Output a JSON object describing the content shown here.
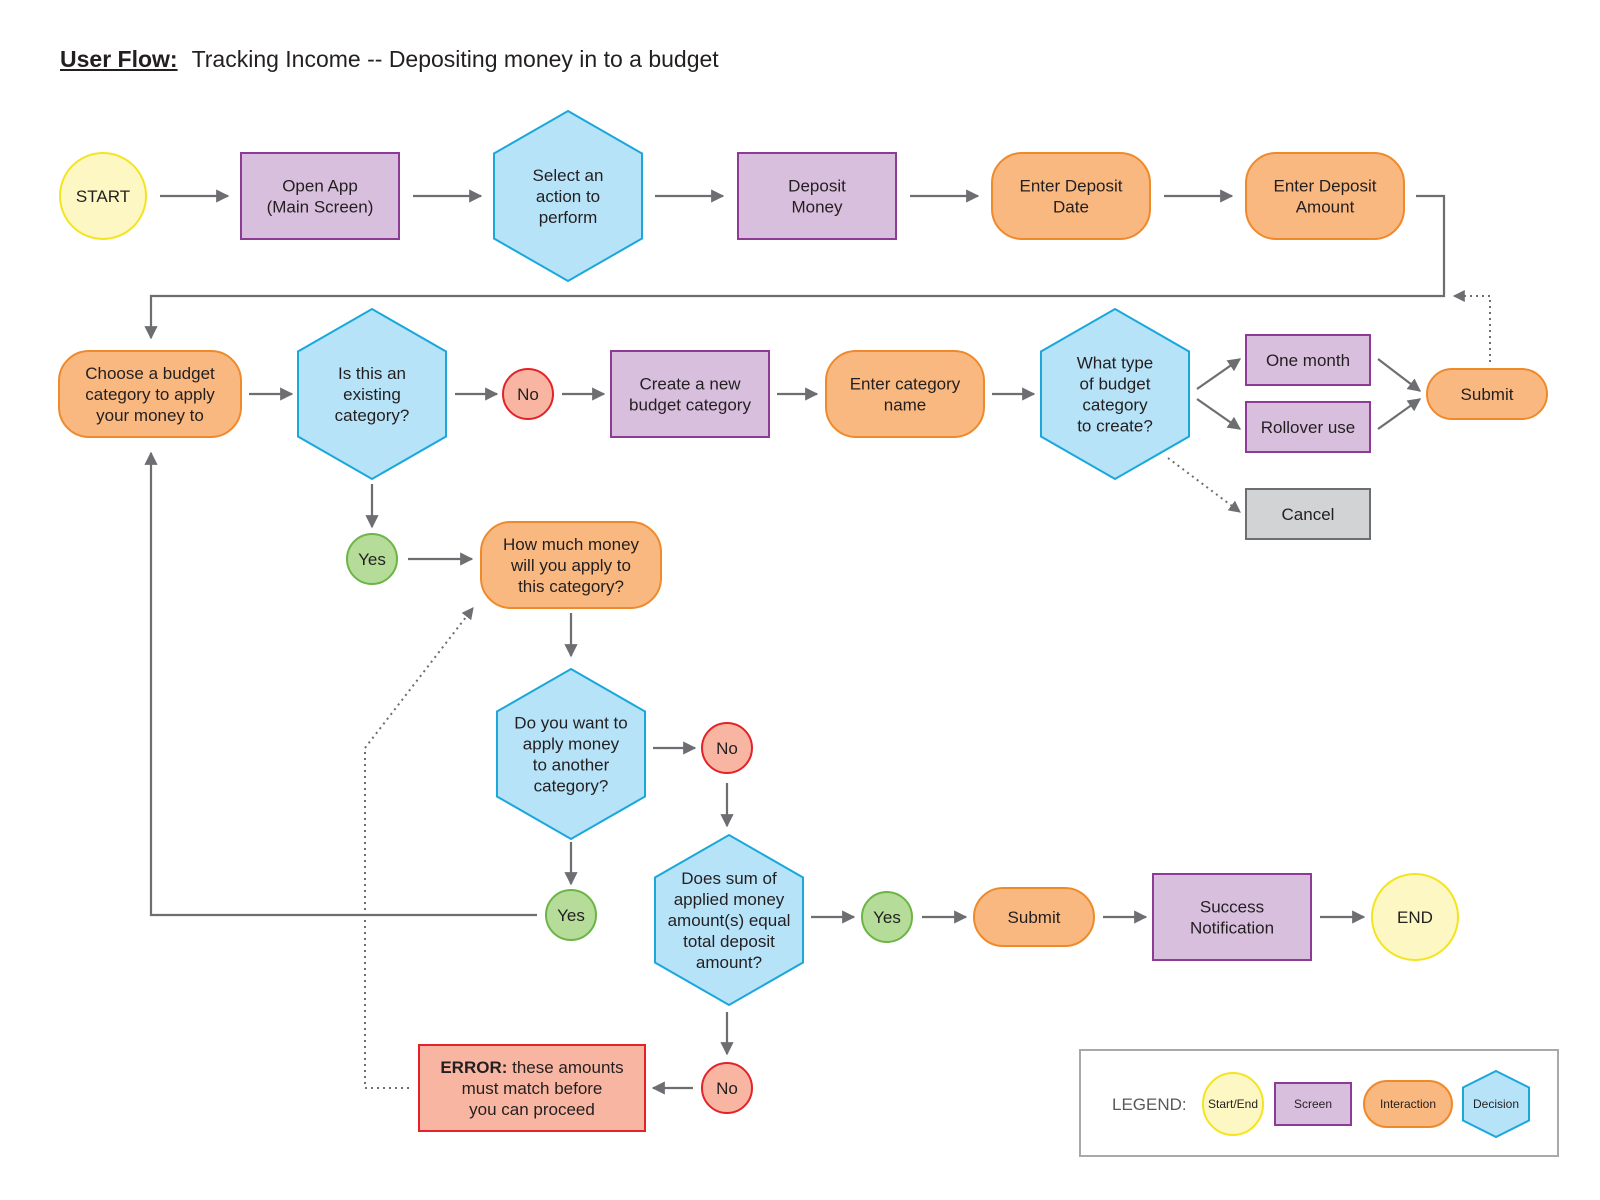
{
  "title": {
    "lead": "User Flow:",
    "text": "Tracking Income -- Depositing money in to a budget"
  },
  "colors": {
    "start_end_fill": "#fdf7c3",
    "start_end_stroke": "#f2e520",
    "screen_fill": "#d9bfde",
    "screen_stroke": "#8e3b96",
    "interaction_fill": "#f9b880",
    "interaction_stroke": "#ef8a2c",
    "decision_fill": "#b7e3f8",
    "decision_stroke": "#1aa7dc",
    "yes_fill": "#b5dc98",
    "yes_stroke": "#6db446",
    "no_fill": "#f8b6a2",
    "no_stroke": "#e2232a",
    "error_fill": "#f8b6a2",
    "error_stroke": "#e2232a",
    "cancel_fill": "#d1d3d4",
    "cancel_stroke": "#6d6e71",
    "edge": "#6d6e71"
  },
  "nodes": {
    "start": {
      "type": "start_end",
      "lines": [
        "START"
      ]
    },
    "open_app": {
      "type": "screen",
      "lines": [
        "Open App",
        "(Main Screen)"
      ]
    },
    "select_action": {
      "type": "decision",
      "lines": [
        "Select an",
        "action to",
        "perform"
      ]
    },
    "deposit_money": {
      "type": "screen",
      "lines": [
        "Deposit",
        "Money"
      ]
    },
    "enter_date": {
      "type": "interaction",
      "lines": [
        "Enter Deposit",
        "Date"
      ]
    },
    "enter_amount": {
      "type": "interaction",
      "lines": [
        "Enter Deposit",
        "Amount"
      ]
    },
    "choose_category": {
      "type": "interaction",
      "lines": [
        "Choose a budget",
        "category to apply",
        "your money to"
      ]
    },
    "existing_category": {
      "type": "decision",
      "lines": [
        "Is this an",
        "existing",
        "category?"
      ]
    },
    "no_1": {
      "type": "no",
      "lines": [
        "No"
      ]
    },
    "create_category": {
      "type": "screen",
      "lines": [
        "Create a new",
        "budget category"
      ]
    },
    "enter_category_name": {
      "type": "interaction",
      "lines": [
        "Enter category",
        "name"
      ]
    },
    "budget_type": {
      "type": "decision",
      "lines": [
        "What type",
        "of budget",
        "category",
        "to create?"
      ]
    },
    "one_month": {
      "type": "screen",
      "lines": [
        "One month"
      ]
    },
    "rollover_use": {
      "type": "screen",
      "lines": [
        "Rollover use"
      ]
    },
    "submit_1": {
      "type": "interaction",
      "lines": [
        "Submit"
      ]
    },
    "cancel": {
      "type": "cancel",
      "lines": [
        "Cancel"
      ]
    },
    "yes_1": {
      "type": "yes",
      "lines": [
        "Yes"
      ]
    },
    "how_much": {
      "type": "interaction",
      "lines": [
        "How much money",
        "will you apply to",
        "this category?"
      ]
    },
    "another_category": {
      "type": "decision",
      "lines": [
        "Do you want to",
        "apply money",
        "to another",
        "category?"
      ]
    },
    "no_2": {
      "type": "no",
      "lines": [
        "No"
      ]
    },
    "yes_2": {
      "type": "yes",
      "lines": [
        "Yes"
      ]
    },
    "sum_equal": {
      "type": "decision",
      "lines": [
        "Does sum of",
        "applied money",
        "amount(s) equal",
        "total deposit",
        "amount?"
      ]
    },
    "yes_3": {
      "type": "yes",
      "lines": [
        "Yes"
      ]
    },
    "submit_2": {
      "type": "interaction",
      "lines": [
        "Submit"
      ]
    },
    "success": {
      "type": "screen",
      "lines": [
        "Success",
        "Notification"
      ]
    },
    "end": {
      "type": "start_end",
      "lines": [
        "END"
      ]
    },
    "no_3": {
      "type": "no",
      "lines": [
        "No"
      ]
    },
    "error": {
      "type": "error",
      "bold": "ERROR:",
      "lines": [
        "these amounts",
        "must match before",
        "you can proceed"
      ]
    }
  },
  "edges": [
    {
      "from": "start",
      "to": "open_app"
    },
    {
      "from": "open_app",
      "to": "select_action"
    },
    {
      "from": "select_action",
      "to": "deposit_money"
    },
    {
      "from": "deposit_money",
      "to": "enter_date"
    },
    {
      "from": "enter_date",
      "to": "enter_amount"
    },
    {
      "from": "enter_amount",
      "to": "choose_category"
    },
    {
      "from": "choose_category",
      "to": "existing_category"
    },
    {
      "from": "existing_category",
      "to": "no_1"
    },
    {
      "from": "no_1",
      "to": "create_category"
    },
    {
      "from": "create_category",
      "to": "enter_category_name"
    },
    {
      "from": "enter_category_name",
      "to": "budget_type"
    },
    {
      "from": "budget_type",
      "to": "one_month"
    },
    {
      "from": "budget_type",
      "to": "rollover_use"
    },
    {
      "from": "budget_type",
      "to": "cancel",
      "style": "dotted"
    },
    {
      "from": "one_month",
      "to": "submit_1"
    },
    {
      "from": "rollover_use",
      "to": "submit_1"
    },
    {
      "from": "submit_1",
      "to": "choose_category",
      "style": "dotted"
    },
    {
      "from": "existing_category",
      "to": "yes_1"
    },
    {
      "from": "yes_1",
      "to": "how_much"
    },
    {
      "from": "how_much",
      "to": "another_category"
    },
    {
      "from": "another_category",
      "to": "no_2"
    },
    {
      "from": "another_category",
      "to": "yes_2"
    },
    {
      "from": "yes_2",
      "to": "choose_category"
    },
    {
      "from": "no_2",
      "to": "sum_equal"
    },
    {
      "from": "sum_equal",
      "to": "yes_3"
    },
    {
      "from": "yes_3",
      "to": "submit_2"
    },
    {
      "from": "submit_2",
      "to": "success"
    },
    {
      "from": "success",
      "to": "end"
    },
    {
      "from": "sum_equal",
      "to": "no_3"
    },
    {
      "from": "no_3",
      "to": "error"
    },
    {
      "from": "error",
      "to": "how_much",
      "style": "dotted"
    }
  ],
  "legend": {
    "label": "LEGEND:",
    "items": [
      {
        "type": "start_end",
        "label": "Start/End"
      },
      {
        "type": "screen",
        "label": "Screen"
      },
      {
        "type": "interaction",
        "label": "Interaction"
      },
      {
        "type": "decision",
        "label": "Decision"
      }
    ]
  }
}
